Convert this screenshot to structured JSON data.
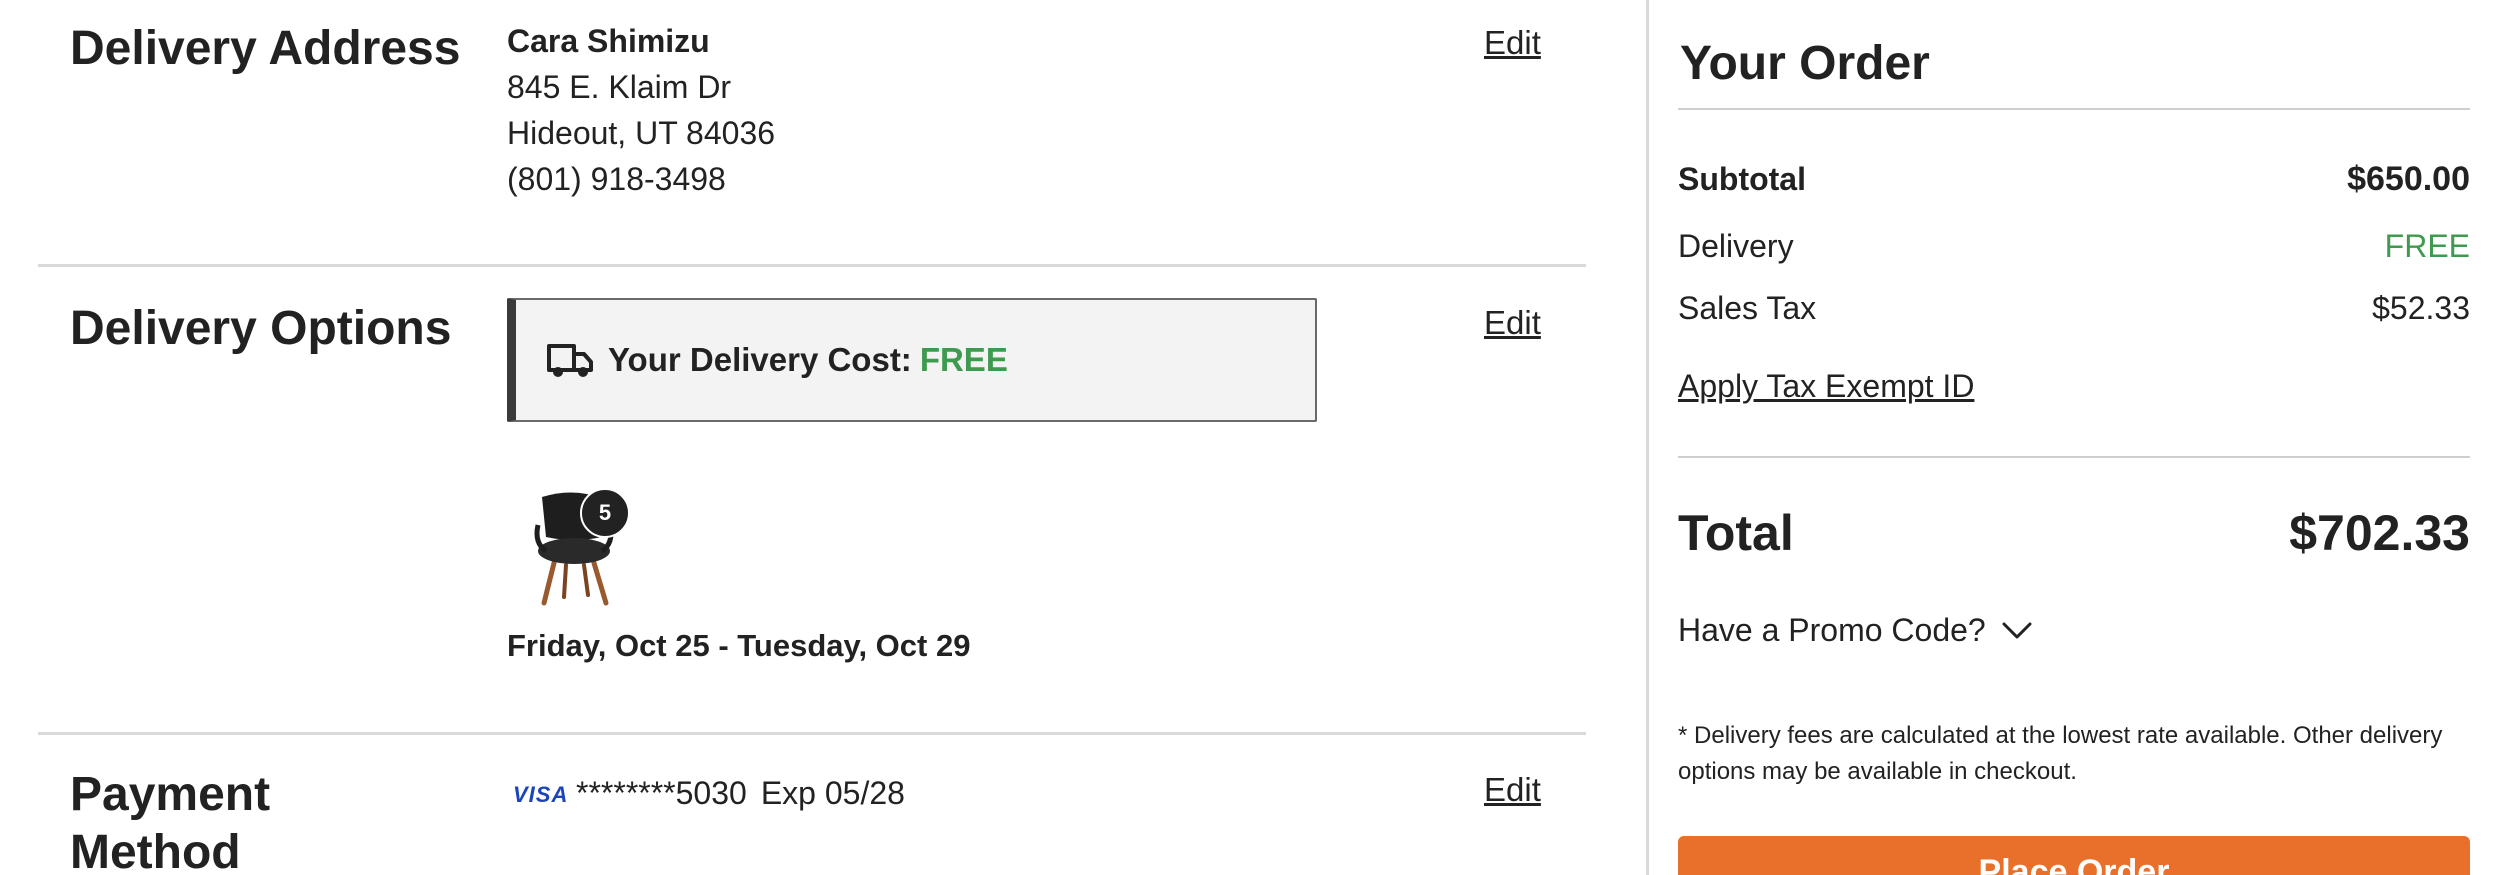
{
  "delivery_address": {
    "title": "Delivery Address",
    "edit_label": "Edit",
    "name": "Cara Shimizu",
    "street": "845 E. Klaim Dr",
    "city_state_zip": "Hideout, UT 84036",
    "phone": "(801) 918-3498"
  },
  "delivery_options": {
    "title": "Delivery Options",
    "edit_label": "Edit",
    "cost_label": "Your Delivery Cost:",
    "cost_value": "FREE",
    "quantity_badge": "5",
    "date_range": "Friday, Oct 25 - Tuesday, Oct 29"
  },
  "payment_method": {
    "title_line1": "Payment",
    "title_line2": "Method",
    "edit_label": "Edit",
    "card_brand": "VISA",
    "card_number": "********5030",
    "expiry": "Exp 05/28"
  },
  "order_summary": {
    "title": "Your Order",
    "subtotal_label": "Subtotal",
    "subtotal_value": "$650.00",
    "delivery_label": "Delivery",
    "delivery_value": "FREE",
    "tax_label": "Sales Tax",
    "tax_value": "$52.33",
    "tax_exempt_link": "Apply Tax Exempt ID",
    "total_label": "Total",
    "total_value": "$702.33",
    "promo_label": "Have a Promo Code?",
    "note": "* Delivery fees are calculated at the lowest rate available. Other delivery options may be available in checkout.",
    "place_order_label": "Place Order"
  },
  "colors": {
    "free_green": "#3e9a4f",
    "place_order_orange": "#e8702a",
    "visa_blue": "#1a44b8"
  },
  "icons": {
    "truck": "truck-icon",
    "chevron": "chevron-down-icon",
    "visa": "visa-logo"
  }
}
